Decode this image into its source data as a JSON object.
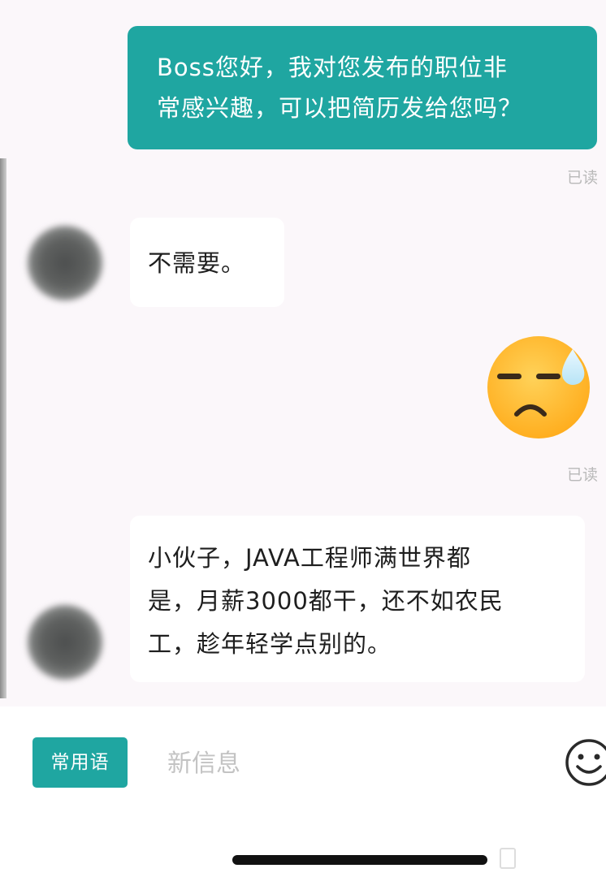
{
  "messages": [
    {
      "side": "out",
      "text_line1": "Boss您好，我对您发布的职位非",
      "text_line2": "常感兴趣，可以把简历发给您吗？",
      "status": "已读"
    },
    {
      "side": "in",
      "text": "不需要。"
    },
    {
      "side": "out",
      "type": "emoji",
      "emoji": "sweat-unamused-emoji-icon",
      "status": "已读"
    },
    {
      "side": "in",
      "text_line1": "小伙子，JAVA工程师满世界都",
      "text_line2": "是，月薪3000都干，还不如农民",
      "text_line3": "工，趁年轻学点别的。"
    }
  ],
  "input_bar": {
    "phrases_label": "常用语",
    "placeholder": "新信息",
    "emoji_icon": "smile-icon"
  },
  "colors": {
    "accent": "#1fa6a1",
    "chat_bg": "#fbf7fa",
    "read_status": "#b9b9b9",
    "emoji_face": "#ffb020"
  }
}
